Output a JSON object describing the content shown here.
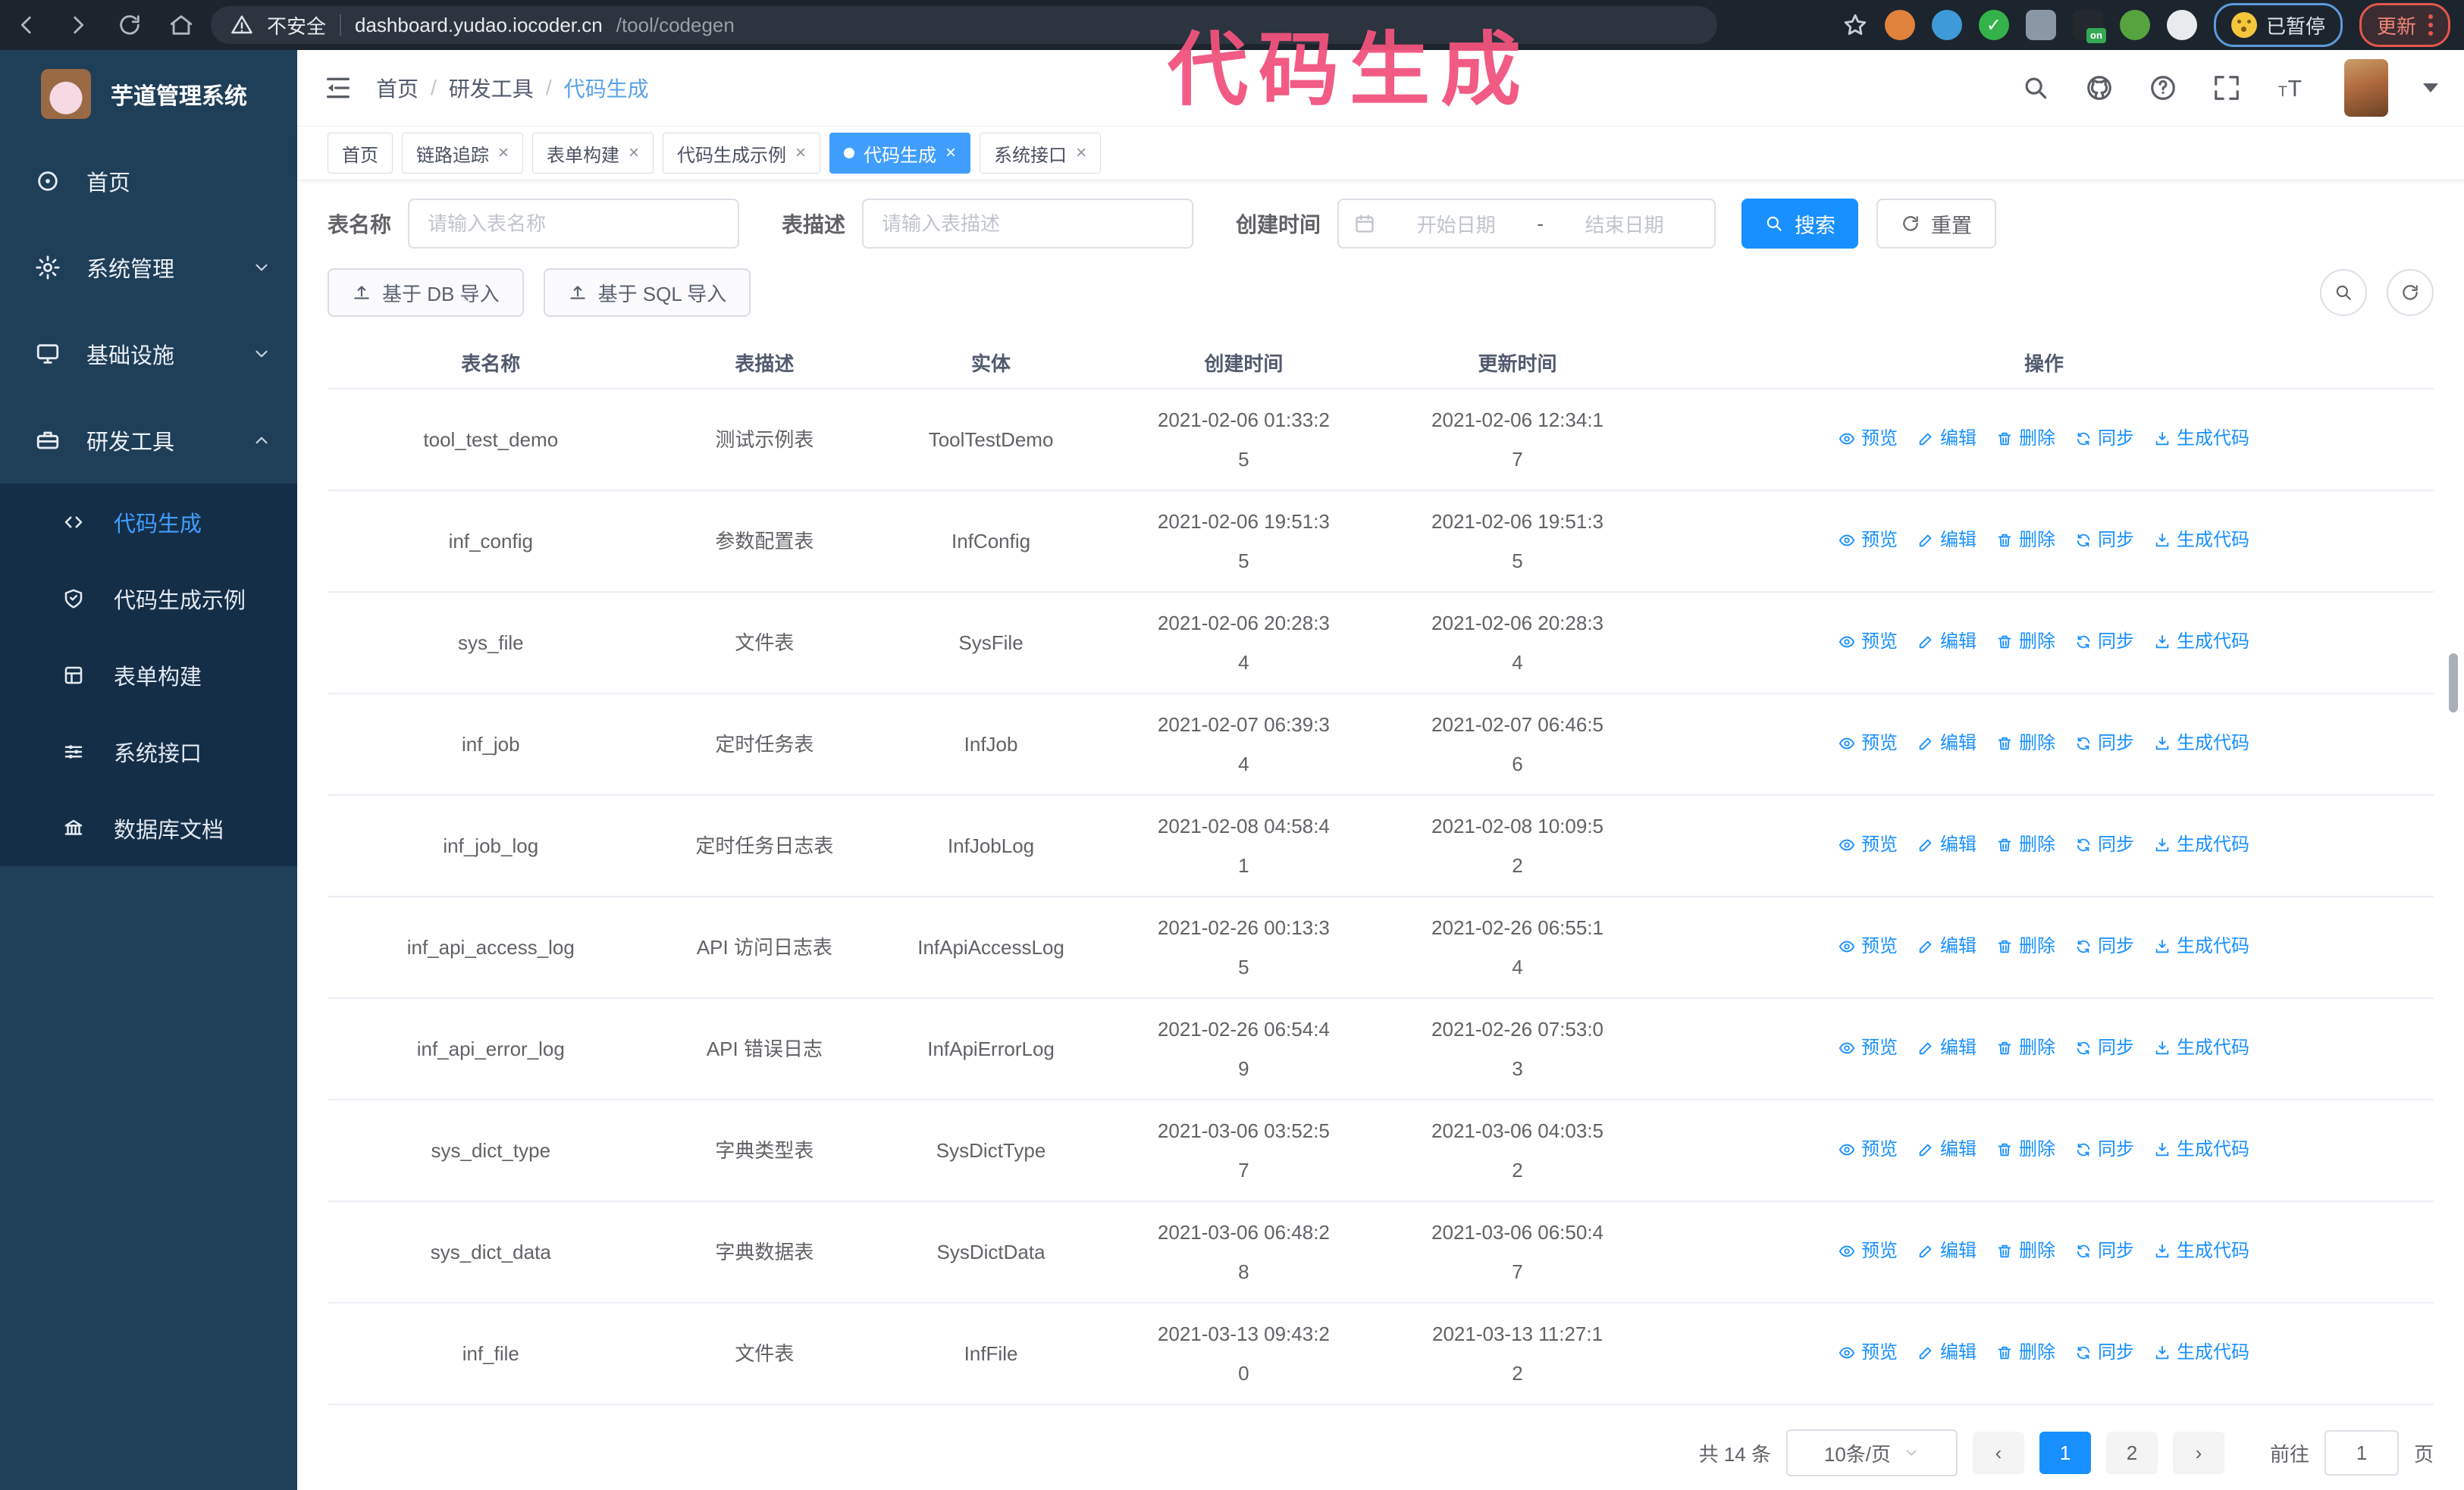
{
  "colors": {
    "accent": "#1890ff",
    "accent-light": "#409eff",
    "chrome-bg": "#1c242e",
    "urlbar-bg": "#2b343f",
    "sidebar-bg": "#1f3e58",
    "sidebar-sub-bg": "#152e47",
    "watermark": "#f2537d",
    "update-red": "#e2574c",
    "paused-blue": "#5b9bd9"
  },
  "watermark": "代码生成",
  "browser": {
    "security_label": "不安全",
    "url_domain": "dashboard.yudao.iocoder.cn",
    "url_path": "/tool/codegen",
    "paused_label": "已暂停",
    "update_label": "更新"
  },
  "icons": {
    "back": "arrow-left",
    "forward": "arrow-right",
    "reload": "circular-arrow",
    "home-nav": "house",
    "security": "warning-triangle",
    "bookmark": "star",
    "collapse": "hamburger-with-arrow",
    "search": "magnifier",
    "github": "octocat-circle",
    "help": "question-circle",
    "fullscreen": "expand-arrows",
    "font-size": "tT",
    "calendar": "calendar",
    "reset": "refresh",
    "import": "upload-arrow",
    "preview": "eye",
    "edit": "pen",
    "delete": "trash",
    "sync": "refresh-arrows",
    "generate": "download-arrow"
  },
  "sidebar": {
    "title": "芋道管理系统",
    "items": [
      {
        "label": "首页",
        "icon": "home-icon",
        "expandable": false
      },
      {
        "label": "系统管理",
        "icon": "gear-icon",
        "expandable": true,
        "expanded": false
      },
      {
        "label": "基础设施",
        "icon": "monitor-icon",
        "expandable": true,
        "expanded": false
      },
      {
        "label": "研发工具",
        "icon": "toolbox-icon",
        "expandable": true,
        "expanded": true
      }
    ],
    "submenu": [
      {
        "label": "代码生成",
        "icon": "code-icon",
        "active": true
      },
      {
        "label": "代码生成示例",
        "icon": "shield-check-icon",
        "active": false
      },
      {
        "label": "表单构建",
        "icon": "form-icon",
        "active": false
      },
      {
        "label": "系统接口",
        "icon": "sliders-icon",
        "active": false
      },
      {
        "label": "数据库文档",
        "icon": "bank-icon",
        "active": false
      }
    ]
  },
  "header": {
    "breadcrumb": [
      "首页",
      "研发工具",
      "代码生成"
    ],
    "separator": "/"
  },
  "tags": {
    "close_glyph": "×",
    "items": [
      {
        "label": "首页",
        "closable": false,
        "active": false
      },
      {
        "label": "链路追踪",
        "closable": true,
        "active": false
      },
      {
        "label": "表单构建",
        "closable": true,
        "active": false
      },
      {
        "label": "代码生成示例",
        "closable": true,
        "active": false
      },
      {
        "label": "代码生成",
        "closable": true,
        "active": true
      },
      {
        "label": "系统接口",
        "closable": true,
        "active": false
      }
    ]
  },
  "filters": {
    "table_name_label": "表名称",
    "table_name_placeholder": "请输入表名称",
    "table_desc_label": "表描述",
    "table_desc_placeholder": "请输入表描述",
    "create_time_label": "创建时间",
    "start_date_placeholder": "开始日期",
    "range_separator": "-",
    "end_date_placeholder": "结束日期",
    "search_label": "搜索",
    "reset_label": "重置"
  },
  "toolbar": {
    "import_db_label": "基于 DB 导入",
    "import_sql_label": "基于 SQL 导入"
  },
  "table": {
    "columns": [
      "表名称",
      "表描述",
      "实体",
      "创建时间",
      "更新时间",
      "操作"
    ],
    "actions": [
      "预览",
      "编辑",
      "删除",
      "同步",
      "生成代码"
    ],
    "rows": [
      {
        "name": "tool_test_demo",
        "desc": "测试示例表",
        "entity": "ToolTestDemo",
        "created": "2021-02-06 01:33:25",
        "updated": "2021-02-06 12:34:17"
      },
      {
        "name": "inf_config",
        "desc": "参数配置表",
        "entity": "InfConfig",
        "created": "2021-02-06 19:51:35",
        "updated": "2021-02-06 19:51:35"
      },
      {
        "name": "sys_file",
        "desc": "文件表",
        "entity": "SysFile",
        "created": "2021-02-06 20:28:34",
        "updated": "2021-02-06 20:28:34"
      },
      {
        "name": "inf_job",
        "desc": "定时任务表",
        "entity": "InfJob",
        "created": "2021-02-07 06:39:34",
        "updated": "2021-02-07 06:46:56"
      },
      {
        "name": "inf_job_log",
        "desc": "定时任务日志表",
        "entity": "InfJobLog",
        "created": "2021-02-08 04:58:41",
        "updated": "2021-02-08 10:09:52"
      },
      {
        "name": "inf_api_access_log",
        "desc": "API 访问日志表",
        "entity": "InfApiAccessLog",
        "created": "2021-02-26 00:13:35",
        "updated": "2021-02-26 06:55:14"
      },
      {
        "name": "inf_api_error_log",
        "desc": "API 错误日志",
        "entity": "InfApiErrorLog",
        "created": "2021-02-26 06:54:49",
        "updated": "2021-02-26 07:53:03"
      },
      {
        "name": "sys_dict_type",
        "desc": "字典类型表",
        "entity": "SysDictType",
        "created": "2021-03-06 03:52:57",
        "updated": "2021-03-06 04:03:52"
      },
      {
        "name": "sys_dict_data",
        "desc": "字典数据表",
        "entity": "SysDictData",
        "created": "2021-03-06 06:48:28",
        "updated": "2021-03-06 06:50:47"
      },
      {
        "name": "inf_file",
        "desc": "文件表",
        "entity": "InfFile",
        "created": "2021-03-13 09:43:20",
        "updated": "2021-03-13 11:27:12"
      }
    ]
  },
  "pagination": {
    "total_label": "共 14 条",
    "page_size_label": "10条/页",
    "prev_glyph": "‹",
    "next_glyph": "›",
    "pages": [
      "1",
      "2"
    ],
    "active_page": "1",
    "goto_label": "前往",
    "goto_value": "1",
    "unit_label": "页"
  }
}
